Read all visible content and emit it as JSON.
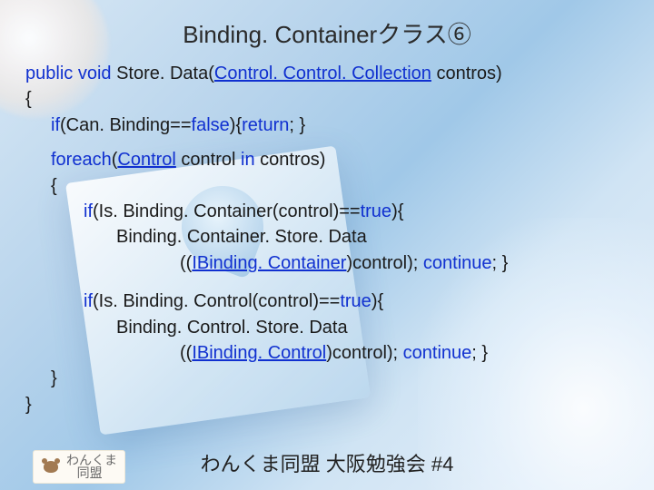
{
  "title": "Binding. Containerクラス⑥",
  "code": {
    "l1a": "public",
    "l1b": " void",
    "l1c": " Store. Data(",
    "l1d": "Control. Control. Collection",
    "l1e": " contros)",
    "l2": "{",
    "l3a": "if",
    "l3b": "(Can. Binding==",
    "l3c": "false",
    "l3d": "){",
    "l3e": "return",
    "l3f": "; }",
    "l4a": "foreach",
    "l4b": "(",
    "l4c": "Control",
    "l4d": " control ",
    "l4e": "in",
    "l4f": " contros)",
    "l5": "{",
    "l6a": "if",
    "l6b": "(Is. Binding. Container(control)==",
    "l6c": "true",
    "l6d": "){",
    "l7": "Binding. Container. Store. Data",
    "l8a": "((",
    "l8b": "IBinding. Container",
    "l8c": ")control); ",
    "l8d": "continue",
    "l8e": "; }",
    "l9a": "if",
    "l9b": "(Is. Binding. Control(control)==",
    "l9c": "true",
    "l9d": "){",
    "l10": "Binding. Control. Store. Data",
    "l11a": "((",
    "l11b": "IBinding. Control",
    "l11c": ")control); ",
    "l11d": "continue",
    "l11e": "; }",
    "l12": "}",
    "l13": "}"
  },
  "footer": "わんくま同盟 大阪勉強会 #4",
  "logo": "わんくま\n   同盟"
}
